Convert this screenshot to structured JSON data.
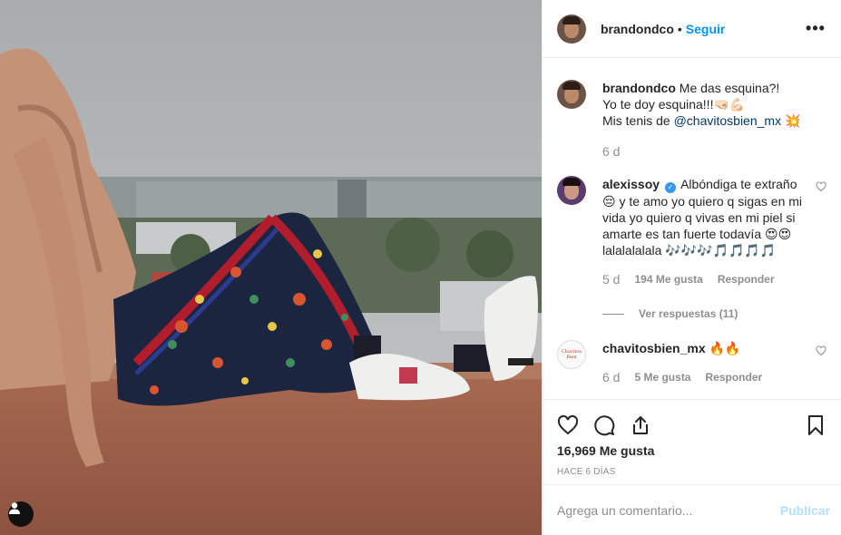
{
  "post": {
    "username": "brandondco",
    "separator": "•",
    "follow_label": "Seguir",
    "more_icon": "more-horizontal-icon",
    "more_label": "•••"
  },
  "caption": {
    "username": "brandondco",
    "line1": "Me das esquina?!",
    "line2": "Yo te doy esquina!!!🤜🏻💪🏻",
    "line3_prefix": "Mis tenis de ",
    "mention": "@chavitosbien_mx",
    "line3_suffix": " 💥",
    "time": "6 d"
  },
  "comments": [
    {
      "username": "alexissoy",
      "verified_icon": "verified-badge-icon",
      "verified_glyph": "✓",
      "text": "Albóndiga te extraño 😔 y te amo yo quiero q sigas en mi vida yo quiero q vivas en mi piel si amarte es tan fuerte todavía 😍😍lalalalalala 🎶🎶🎶🎵🎵🎵🎵",
      "time": "5 d",
      "likes": "194 Me gusta",
      "reply": "Responder",
      "view_replies": "Ver respuestas (11)"
    },
    {
      "username": "chavitosbien_mx",
      "text": "🔥🔥",
      "time": "6 d",
      "likes": "5 Me gusta",
      "reply": "Responder",
      "avatar_text": "Chavitos Bien"
    }
  ],
  "actions": {
    "like_icon": "heart-icon",
    "comment_icon": "comment-icon",
    "share_icon": "share-icon",
    "save_icon": "bookmark-icon",
    "likes_count": "16,969 Me gusta",
    "posted_ago": "HACE 6 DÍAS"
  },
  "add_comment": {
    "placeholder": "Agrega un comentario...",
    "post_label": "Publicar"
  },
  "colors": {
    "accent": "#0095f6",
    "post_disabled": "#b2dffc",
    "muted": "#8e8e8e"
  }
}
